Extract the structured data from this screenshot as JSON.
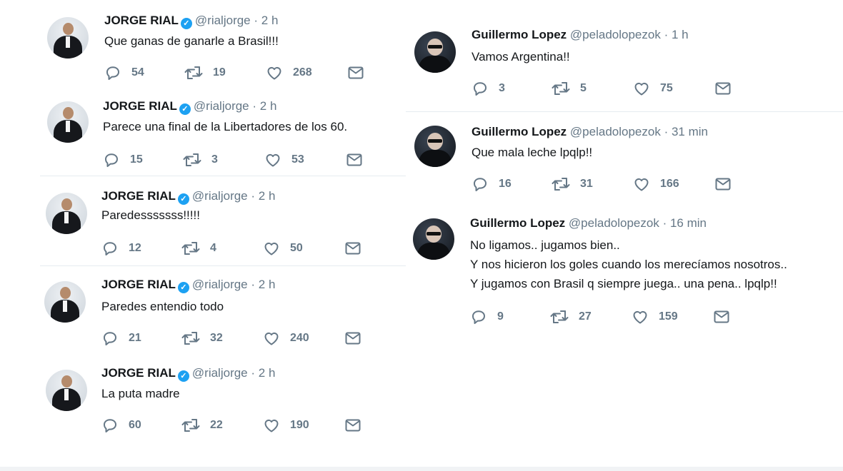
{
  "colors": {
    "name": "#14171a",
    "meta": "#657786",
    "verified": "#1da1f2",
    "divider": "#e6ecf0"
  },
  "icons": {
    "reply": "reply-icon",
    "retweet": "retweet-icon",
    "like": "heart-icon",
    "dm": "envelope-icon",
    "verified": "verified-badge-icon"
  },
  "left_tweets": [
    {
      "name": "JORGE RIAL",
      "handle": "@rialjorge",
      "dot": "·",
      "time": "2 h",
      "text": [
        "Que ganas de ganarle a Brasil!!!"
      ],
      "replies": "54",
      "retweets": "19",
      "likes": "268"
    },
    {
      "name": "JORGE RIAL",
      "handle": "@rialjorge",
      "dot": "·",
      "time": "2 h",
      "text": [
        "Parece una final de la Libertadores de los 60."
      ],
      "replies": "15",
      "retweets": "3",
      "likes": "53"
    },
    {
      "name": "JORGE RIAL",
      "handle": "@rialjorge",
      "dot": "·",
      "time": "2 h",
      "text": [
        "Paredesssssss!!!!!"
      ],
      "replies": "12",
      "retweets": "4",
      "likes": "50"
    },
    {
      "name": "JORGE RIAL",
      "handle": "@rialjorge",
      "dot": "·",
      "time": "2 h",
      "text": [
        "Paredes entendio todo"
      ],
      "replies": "21",
      "retweets": "32",
      "likes": "240"
    },
    {
      "name": "JORGE RIAL",
      "handle": "@rialjorge",
      "dot": "·",
      "time": "2 h",
      "text": [
        "La puta madre"
      ],
      "replies": "60",
      "retweets": "22",
      "likes": "190"
    }
  ],
  "right_tweets": [
    {
      "name": "Guillermo Lopez",
      "handle": "@peladolopezok",
      "dot": "·",
      "time": "1 h",
      "text": [
        "Vamos Argentina!!"
      ],
      "replies": "3",
      "retweets": "5",
      "likes": "75"
    },
    {
      "name": "Guillermo Lopez",
      "handle": "@peladolopezok",
      "dot": "·",
      "time": "31 min",
      "text": [
        "Que mala leche lpqlp!!"
      ],
      "replies": "16",
      "retweets": "31",
      "likes": "166"
    },
    {
      "name": "Guillermo Lopez",
      "handle": "@peladolopezok",
      "dot": "·",
      "time": "16 min",
      "text": [
        "No ligamos.. jugamos bien..",
        "Y nos hicieron los goles cuando los merecíamos nosotros..",
        "Y jugamos con Brasil q siempre juega.. una pena.. lpqlp!!"
      ],
      "replies": "9",
      "retweets": "27",
      "likes": "159"
    }
  ]
}
